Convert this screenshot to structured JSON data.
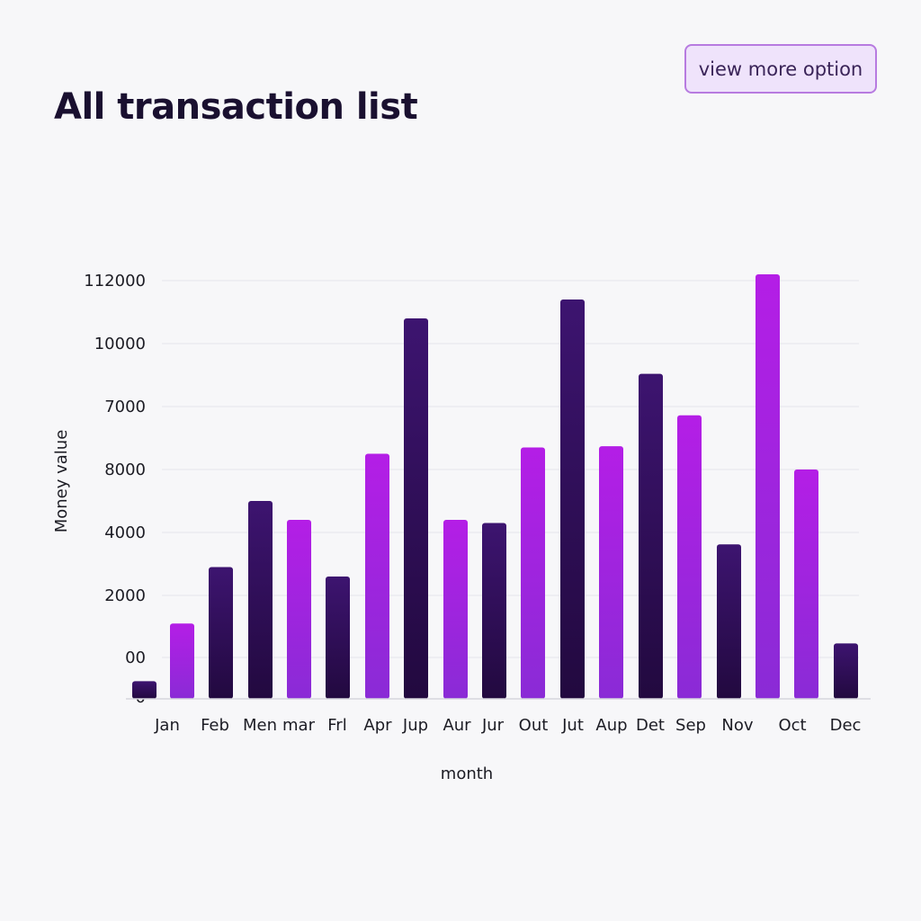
{
  "header": {
    "title": "All transaction list",
    "more_button": "view more option"
  },
  "colors": {
    "dark_bar": "#2e0f57",
    "light_bar": "#b41ee6",
    "grid": "#e4e4ea",
    "background": "#f7f7f9"
  },
  "chart_data": {
    "type": "bar",
    "title": "All transaction list",
    "xlabel": "month",
    "ylabel": "Money value",
    "grid": true,
    "y_tick_labels": [
      "0",
      "00",
      "2000",
      "4000",
      "8000",
      "7000",
      "10000",
      "112000"
    ],
    "categories": [
      "Jan",
      "Feb",
      "Men",
      "mar",
      "Frl",
      "Apr",
      "Jup",
      "Aur",
      "Jur",
      "Out",
      "Jut",
      "Aup",
      "Det",
      "Sep",
      "Nov",
      "Oct",
      "Dec"
    ],
    "series": [
      {
        "values": [
          100,
          660,
          1450,
          2500,
          2200,
          1300,
          3250,
          5400,
          2200,
          2150,
          3350,
          5700,
          3370,
          4520,
          3860,
          1810,
          6100,
          3000,
          420
        ]
      }
    ],
    "bar_colors": [
      "dark",
      "light",
      "dark",
      "dark",
      "light",
      "dark",
      "light",
      "dark",
      "light",
      "dark",
      "light",
      "dark",
      "light",
      "dark",
      "light",
      "dark",
      "light",
      "light",
      "dark"
    ],
    "ylim": [
      0,
      7
    ]
  }
}
